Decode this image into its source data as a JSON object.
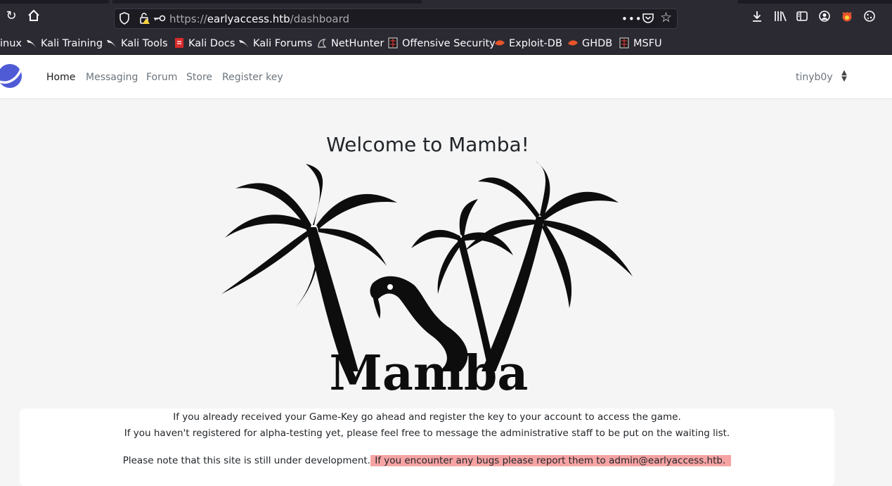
{
  "browser": {
    "url_prefix": "https://",
    "url_host": "earlyaccess.htb",
    "url_path": "/dashboard",
    "menu_dots": "•••",
    "bookmarks": [
      {
        "label": "inux",
        "icon": "none"
      },
      {
        "label": "Kali Training",
        "icon": "kali-dragon-icon"
      },
      {
        "label": "Kali Tools",
        "icon": "kali-dragon-icon"
      },
      {
        "label": "Kali Docs",
        "icon": "kali-docs-icon"
      },
      {
        "label": "Kali Forums",
        "icon": "kali-dragon-icon"
      },
      {
        "label": "NetHunter",
        "icon": "nethunter-icon"
      },
      {
        "label": "Offensive Security",
        "icon": "offsec-icon"
      },
      {
        "label": "Exploit-DB",
        "icon": "exploitdb-icon"
      },
      {
        "label": "GHDB",
        "icon": "ghdb-icon"
      },
      {
        "label": "MSFU",
        "icon": "msfu-icon"
      }
    ]
  },
  "site": {
    "nav": [
      {
        "label": "Home",
        "active": true
      },
      {
        "label": "Messaging",
        "active": false
      },
      {
        "label": "Forum",
        "active": false
      },
      {
        "label": "Store",
        "active": false
      },
      {
        "label": "Register key",
        "active": false
      }
    ],
    "user": "tinyb0y",
    "title": "Welcome to Mamba!",
    "logo_text": "Mamba",
    "paragraphs": {
      "line1": "If you already received your Game-Key go ahead and register the key to your account to access the game.",
      "line2": "If you haven't registered for alpha-testing yet, please feel free to message the administrative staff to be put on the waiting list.",
      "line3_plain": "Please note that this site is still under development.",
      "line3_highlight": " If you encounter any bugs please report them to admin@earlyaccess.htb."
    },
    "colors": {
      "logo_blue": "#4f5bd5",
      "highlight": "#f5a3a3"
    }
  }
}
